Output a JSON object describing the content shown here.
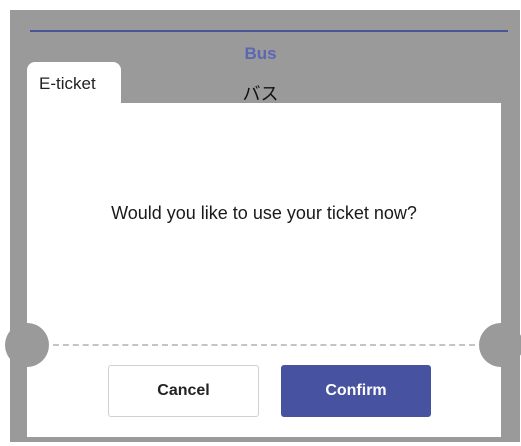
{
  "header": {
    "title": "Bus",
    "subtitle": "バス"
  },
  "ticket": {
    "tab_label": "E-ticket"
  },
  "dialog": {
    "message": "Would you like to use your ticket now?",
    "cancel_label": "Cancel",
    "confirm_label": "Confirm"
  },
  "colors": {
    "accent": "#4752a0",
    "title": "#5b67b1",
    "overlay": "#9a9a9a"
  }
}
